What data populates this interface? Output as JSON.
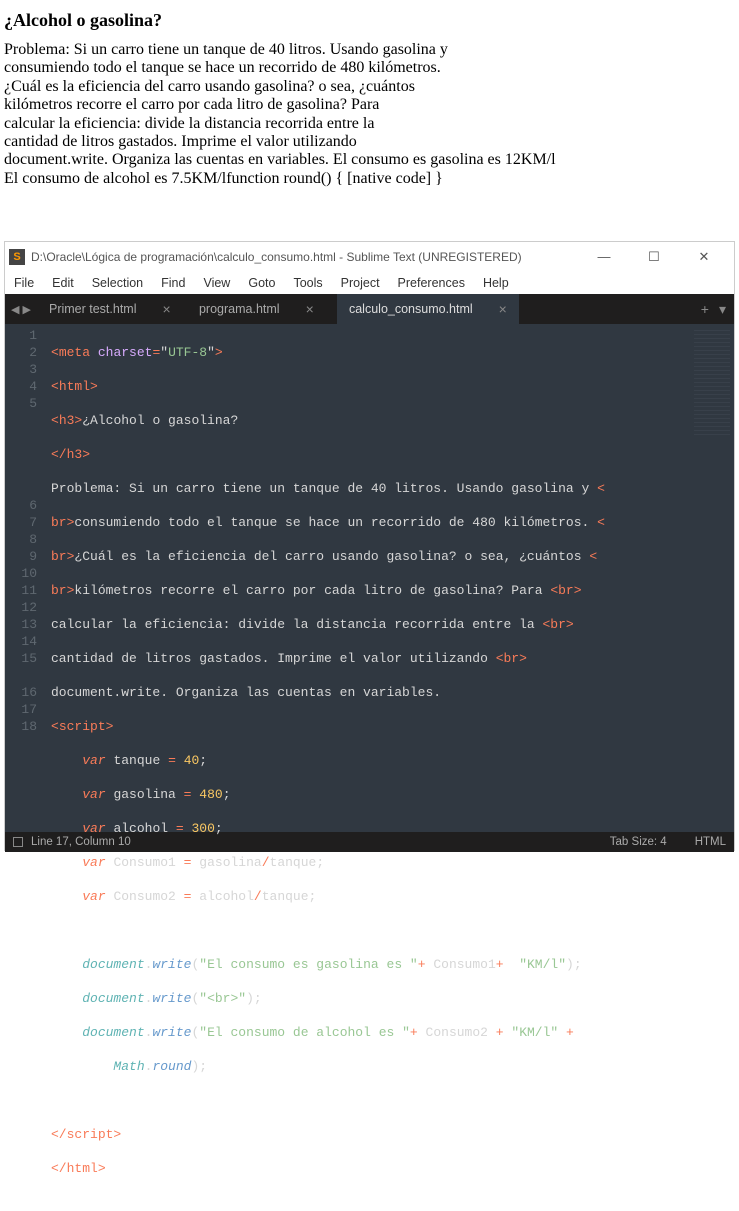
{
  "output": {
    "heading": "¿Alcohol o gasolina?",
    "lines": [
      "Problema: Si un carro tiene un tanque de 40 litros. Usando gasolina y",
      "consumiendo todo el tanque se hace un recorrido de 480 kilómetros.",
      "¿Cuál es la eficiencia del carro usando gasolina? o sea, ¿cuántos",
      "kilómetros recorre el carro por cada litro de gasolina? Para",
      "calcular la eficiencia: divide la distancia recorrida entre la",
      "cantidad de litros gastados. Imprime el valor utilizando",
      "document.write. Organiza las cuentas en variables. El consumo es gasolina es 12KM/l",
      "El consumo de alcohol es 7.5KM/lfunction round() { [native code] }"
    ]
  },
  "window": {
    "title": "D:\\Oracle\\Lógica de programación\\calculo_consumo.html - Sublime Text (UNREGISTERED)",
    "controls": {
      "min": "—",
      "max": "☐",
      "close": "✕"
    }
  },
  "menu": [
    "File",
    "Edit",
    "Selection",
    "Find",
    "View",
    "Goto",
    "Tools",
    "Project",
    "Preferences",
    "Help"
  ],
  "tabs": [
    {
      "label": "Primer test.html",
      "active": false
    },
    {
      "label": "programa.html",
      "active": false
    },
    {
      "label": "calculo_consumo.html",
      "active": true
    }
  ],
  "gutter_numbers": [
    "1",
    "2",
    "3",
    "4",
    "5",
    "",
    "",
    "",
    "",
    "",
    "6",
    "7",
    "8",
    "9",
    "10",
    "11",
    "12",
    "13",
    "14",
    "15",
    "",
    "16",
    "17",
    "18"
  ],
  "code_lines": {
    "l1": {
      "open": "<",
      "tag": "meta",
      "sp": " ",
      "attr": "charset",
      "eq": "=",
      "q1": "\"",
      "val": "UTF-8",
      "q2": "\"",
      "close": ">"
    },
    "l2": {
      "open": "<",
      "tag": "html",
      "close": ">"
    },
    "l3": {
      "open": "<",
      "tag": "h3",
      "close": ">",
      "text": "¿Alcohol o gasolina?"
    },
    "l4": {
      "open": "</",
      "tag": "h3",
      "close": ">"
    },
    "l5a": "Problema: Si un carro tiene un tanque de 40 litros. Usando gasolina y ",
    "l5b": "consumiendo todo el tanque se hace un recorrido de 480 kilómetros. ",
    "l5c": "¿Cuál es la eficiencia del carro usando gasolina? o sea, ¿cuántos ",
    "l5d": "kilómetros recorre el carro por cada litro de gasolina? Para ",
    "l5e": "calcular la eficiencia: divide la distancia recorrida entre la ",
    "l5f": "cantidad de litros gastados. Imprime el valor utilizando ",
    "l5g": "document.write. Organiza las cuentas en variables.",
    "br_open": "<",
    "br_tag": "br",
    "br_close": ">",
    "l6": {
      "open": "<",
      "tag": "script",
      "close": ">"
    },
    "l7": {
      "kw": "var",
      "name": "tanque",
      "eq": "=",
      "num": "40"
    },
    "l8": {
      "kw": "var",
      "name": "gasolina",
      "eq": "=",
      "num": "480"
    },
    "l9": {
      "kw": "var",
      "name": "alcohol",
      "eq": "=",
      "num": "300"
    },
    "l10": {
      "kw": "var",
      "name": "Consumo1",
      "eq": "=",
      "a": "gasolina",
      "op": "/",
      "b": "tanque"
    },
    "l11": {
      "kw": "var",
      "name": "Consumo2",
      "eq": "=",
      "a": "alcohol",
      "op": "/",
      "b": "tanque"
    },
    "l13": {
      "obj": "document",
      "dot": ".",
      "fn": "write",
      "lp": "(",
      "s": "\"El consumo es gasolina es \"",
      "plus": "+",
      "v": "Consumo1",
      "plus2": "+",
      "s2": "\"KM/l\"",
      "rp": ")",
      "semi": ";"
    },
    "l14": {
      "obj": "document",
      "dot": ".",
      "fn": "write",
      "lp": "(",
      "s": "\"<br>\"",
      "rp": ")",
      "semi": ";"
    },
    "l15": {
      "obj": "document",
      "dot": ".",
      "fn": "write",
      "lp": "(",
      "s": "\"El consumo de alcohol es \"",
      "plus": "+",
      "v": "Consumo2",
      "plus2": "+",
      "s2": "\"KM/l\"",
      "plus3": "+"
    },
    "l15b": {
      "obj": "Math",
      "dot": ".",
      "fn": "round",
      "rp": ")",
      "semi": ";"
    },
    "l17": {
      "open": "</",
      "tag": "script",
      "close": ">"
    },
    "l18": {
      "open": "</",
      "tag": "html",
      "close": ">"
    }
  },
  "status": {
    "left": "Line 17, Column 10",
    "tabsize": "Tab Size: 4",
    "lang": "HTML"
  }
}
